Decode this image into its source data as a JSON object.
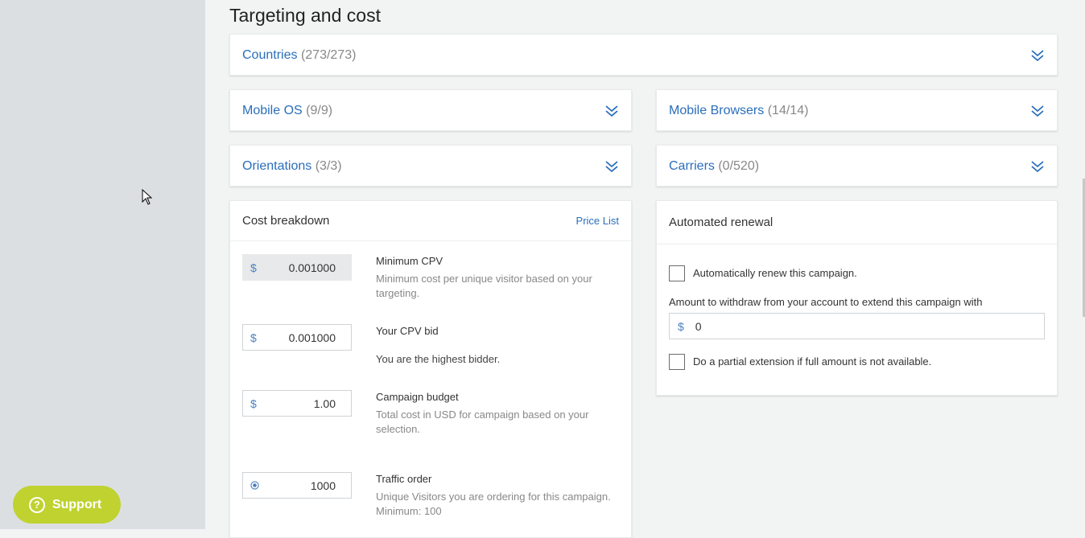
{
  "section_title": "Targeting and cost",
  "support": {
    "label": "Support",
    "icon": "?"
  },
  "accordions": {
    "countries": {
      "name": "Countries",
      "count": "(273/273)"
    },
    "mobile_os": {
      "name": "Mobile OS",
      "count": "(9/9)"
    },
    "mobile_browsers": {
      "name": "Mobile Browsers",
      "count": "(14/14)"
    },
    "orientations": {
      "name": "Orientations",
      "count": "(3/3)"
    },
    "carriers": {
      "name": "Carriers",
      "count": "(0/520)"
    }
  },
  "cost": {
    "title": "Cost breakdown",
    "price_list": "Price List",
    "min_cpv": {
      "currency": "$",
      "value": "0.001000",
      "label": "Minimum CPV",
      "desc": "Minimum cost per unique visitor based on your targeting."
    },
    "cpv_bid": {
      "currency": "$",
      "value": "0.001000",
      "label": "Your CPV bid",
      "desc": "You are the highest bidder."
    },
    "budget": {
      "currency": "$",
      "value": "1.00",
      "label": "Campaign budget",
      "desc": "Total cost in USD for campaign based on your selection."
    },
    "traffic": {
      "value": "1000",
      "label": "Traffic order",
      "desc": "Unique Visitors you are ordering for this campaign. Minimum: 100"
    }
  },
  "renewal": {
    "title": "Automated renewal",
    "auto_renew_label": "Automatically renew this campaign.",
    "amount_label": "Amount to withdraw from your account to extend this campaign with",
    "currency": "$",
    "amount_value": "0",
    "partial_label": "Do a partial extension if full amount is not available."
  },
  "colors": {
    "link": "#2a6ebb",
    "support": "#bfd22f",
    "sidebar": "#dcdfe2",
    "background": "#f2f3f3"
  }
}
